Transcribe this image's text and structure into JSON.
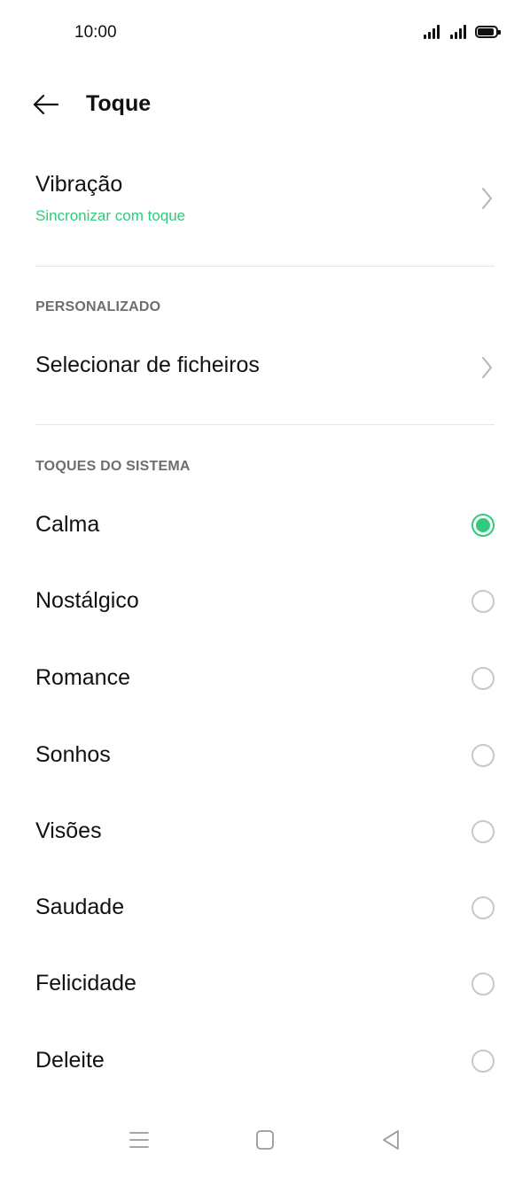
{
  "status_bar": {
    "time": "10:00",
    "icons": [
      "signal-icon",
      "signal-icon",
      "battery-icon"
    ]
  },
  "app_bar": {
    "title": "Toque",
    "back_icon": "arrow-left-icon"
  },
  "vibration": {
    "title": "Vibração",
    "subtitle": "Sincronizar com toque",
    "chevron_icon": "chevron-right-icon"
  },
  "custom_section": {
    "header": "PERSONALIZADO",
    "select_files_label": "Selecionar de ficheiros",
    "chevron_icon": "chevron-right-icon"
  },
  "system_section": {
    "header": "TOQUES DO SISTEMA",
    "ringtones": [
      {
        "label": "Calma",
        "selected": true
      },
      {
        "label": "Nostálgico",
        "selected": false
      },
      {
        "label": "Romance",
        "selected": false
      },
      {
        "label": "Sonhos",
        "selected": false
      },
      {
        "label": "Visões",
        "selected": false
      },
      {
        "label": "Saudade",
        "selected": false
      },
      {
        "label": "Felicidade",
        "selected": false
      },
      {
        "label": "Deleite",
        "selected": false
      }
    ]
  },
  "nav_bar": {
    "icons": [
      "menu-icon",
      "home-icon",
      "back-triangle-icon"
    ]
  },
  "colors": {
    "accent": "#2ecb7a",
    "text_primary": "#111111",
    "text_secondary": "#6e6e6e",
    "divider": "#e6e6e6",
    "radio_unchecked": "#c8c8c8"
  }
}
